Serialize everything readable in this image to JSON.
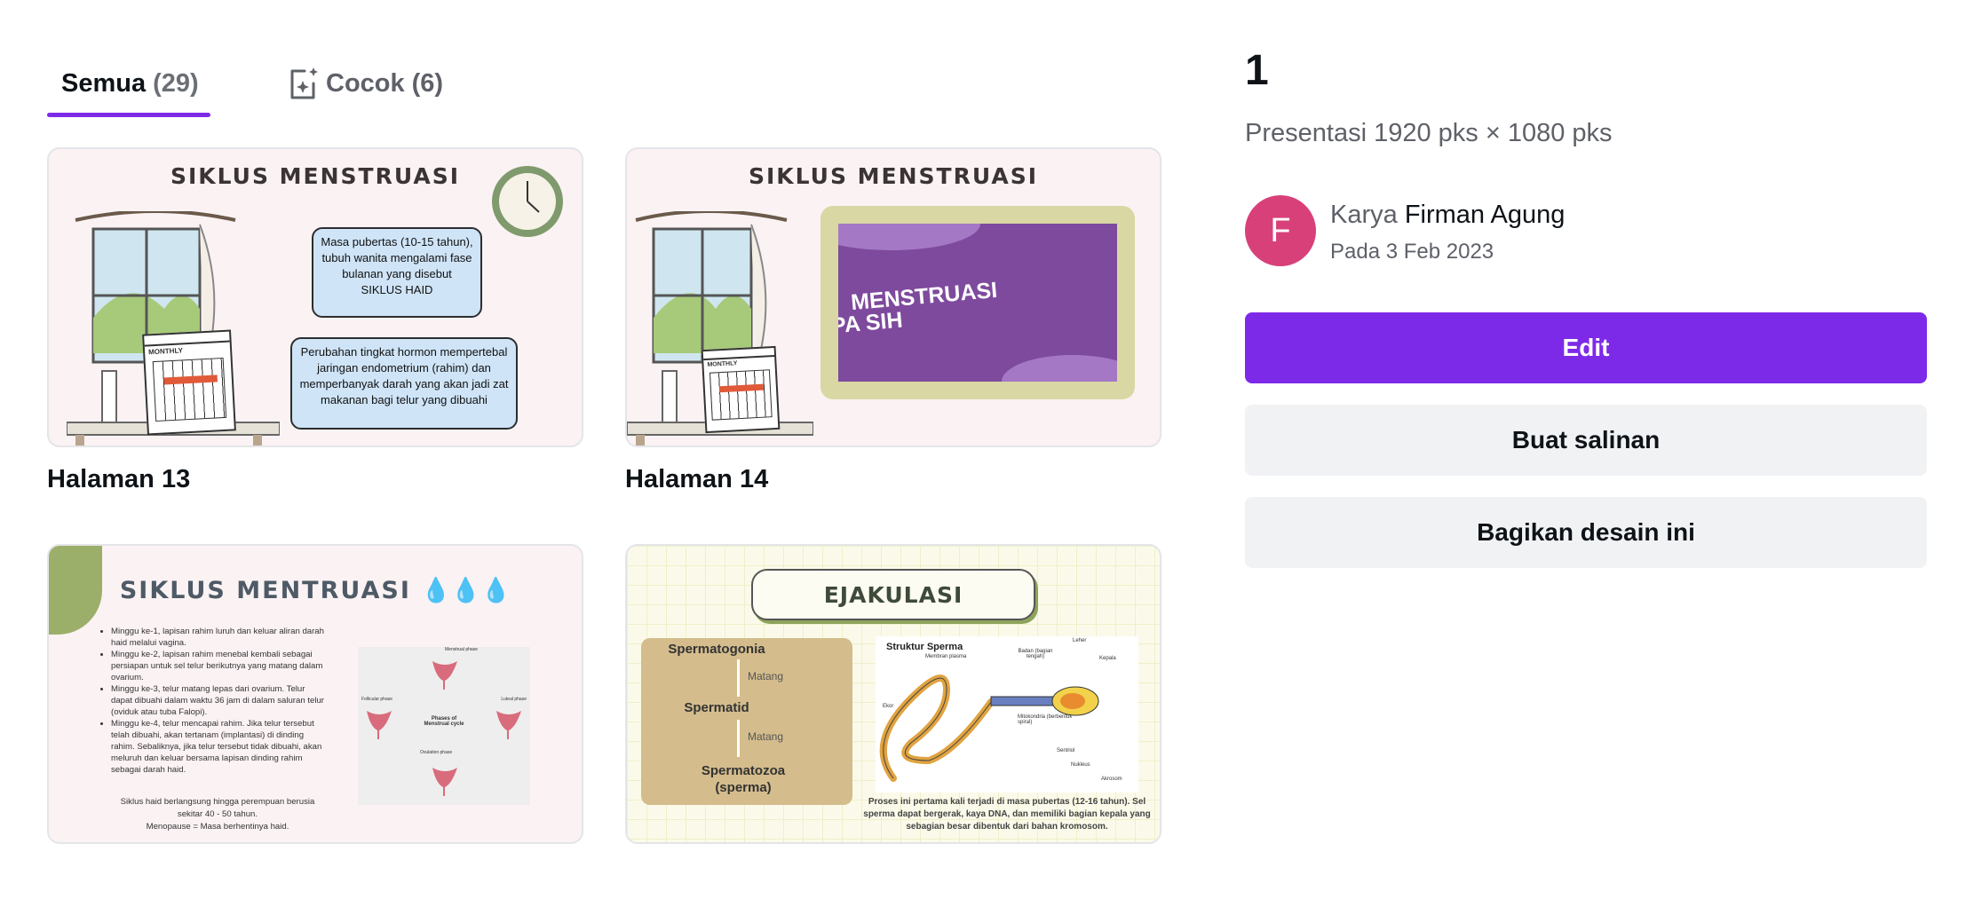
{
  "tabs": [
    {
      "label": "Semua",
      "count": "(29)"
    },
    {
      "label": "Cocok",
      "count": "(6)"
    }
  ],
  "pages": [
    {
      "label": "Halaman 13",
      "slide_title": "SIKLUS MENSTRUASI",
      "bubble1": "Masa pubertas (10-15 tahun), tubuh wanita mengalami fase bulanan yang disebut SIKLUS HAID",
      "bubble2": "Perubahan tingkat hormon mempertebal jaringan endometrium (rahim) dan memperbanyak darah yang akan jadi zat makanan bagi telur yang dibuahi",
      "calendar": "MONTHLY"
    },
    {
      "label": "Halaman 14",
      "slide_title": "SIKLUS MENSTRUASI",
      "video_text_line1": "MENSTRUASI",
      "video_text_line2": "PA SIH",
      "calendar": "MONTHLY"
    },
    {
      "label": "",
      "slide_title": "SIKLUS MENTRUASI",
      "bullets": [
        "Minggu ke-1, lapisan rahim luruh dan keluar aliran darah haid melalui vagina.",
        "Minggu ke-2, lapisan rahim menebal kembali sebagai persiapan untuk sel telur berikutnya yang matang dalam ovarium.",
        "Minggu ke-3, telur matang lepas dari ovarium. Telur dapat dibuahi dalam waktu 36 jam di dalam saluran telur (oviduk atau tuba Falopi).",
        "Minggu ke-4, telur mencapai rahim. Jika telur tersebut telah dibuahi, akan tertanam (implantasi) di dinding rahim. Sebaliknya, jika telur tersebut tidak dibuahi, akan meluruh dan keluar bersama lapisan dinding rahim sebagai darah haid."
      ],
      "footer1": "Siklus haid berlangsung hingga perempuan berusia sekitar 40 - 50 tahun.",
      "footer2": "Menopause = Masa berhentinya haid.",
      "cycle_labels": [
        "Menstrual phase",
        "Follicular phase",
        "Luteal phase",
        "Ovulation phase",
        "Phases of Menstrual cycle"
      ]
    },
    {
      "label": "",
      "slide_title": "EJAKULASI",
      "steps": [
        "Spermatogonia",
        "Matang",
        "Spermatid",
        "Matang",
        "Spermatozoa (sperma)"
      ],
      "diagram_title": "Struktur Sperma",
      "diagram_labels": [
        "Membran plasma",
        "Badan (bagian tengah)",
        "Leher",
        "Kepala",
        "Ekor",
        "Mitokondria (berbentuk spiral)",
        "Sentriol",
        "Nukleus",
        "Akrosom"
      ],
      "caption": "Proses ini pertama kali terjadi di masa pubertas (12-16 tahun). Sel sperma dapat bergerak, kaya DNA, dan memiliki bagian kepala yang sebagian besar dibentuk dari bahan kromosom."
    }
  ],
  "panel": {
    "page_number": "1",
    "dimensions": "Presentasi 1920 pks × 1080 pks",
    "avatar_letter": "F",
    "author_prefix": "Karya",
    "author_name": "Firman Agung",
    "date": "Pada 3 Feb 2023",
    "edit_label": "Edit",
    "copy_label": "Buat salinan",
    "share_label": "Bagikan desain ini"
  },
  "colors": {
    "accent": "#7d2ae8",
    "avatar": "#d8407a",
    "button_secondary": "#f1f2f4"
  }
}
